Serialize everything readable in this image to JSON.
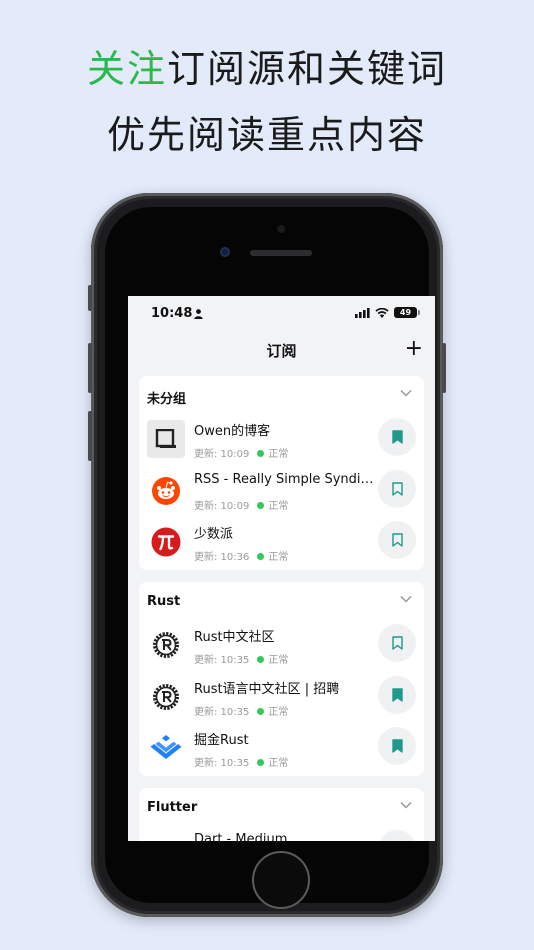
{
  "headline": {
    "line1_accent": "关注",
    "line1_rest": "订阅源和关键词",
    "line2": "优先阅读重点内容"
  },
  "colors": {
    "accent_green": "#2db84e",
    "bookmark_teal": "#1f9a8a",
    "status_green": "#34c759"
  },
  "status_bar": {
    "time": "10:48",
    "battery": "49"
  },
  "nav": {
    "title": "订阅",
    "add_icon": "+"
  },
  "groups": [
    {
      "name": "未分组",
      "items": [
        {
          "title": "Owen的博客",
          "meta": "更新: 10:09",
          "status": "正常",
          "icon": "square-logo-icon",
          "bookmarked": true
        },
        {
          "title": "RSS - Really Simple Syndication",
          "meta": "更新: 10:09",
          "status": "正常",
          "icon": "reddit-icon",
          "bookmarked": false
        },
        {
          "title": "少数派",
          "meta": "更新: 10:36",
          "status": "正常",
          "icon": "pi-icon",
          "bookmarked": false
        }
      ]
    },
    {
      "name": "Rust",
      "items": [
        {
          "title": "Rust中文社区",
          "meta": "更新: 10:35",
          "status": "正常",
          "icon": "rust-gear-icon",
          "bookmarked": false
        },
        {
          "title": "Rust语言中文社区 | 招聘",
          "meta": "更新: 10:35",
          "status": "正常",
          "icon": "rust-gear-icon",
          "bookmarked": true
        },
        {
          "title": "掘金Rust",
          "meta": "更新: 10:35",
          "status": "正常",
          "icon": "juejin-icon",
          "bookmarked": true
        }
      ]
    },
    {
      "name": "Flutter",
      "items": [
        {
          "title": "Dart - Medium"
        }
      ]
    }
  ]
}
